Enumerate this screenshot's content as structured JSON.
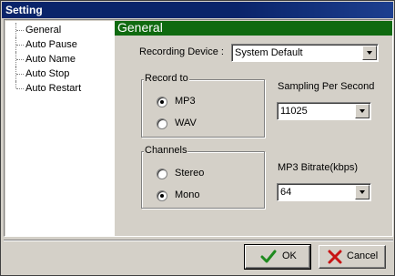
{
  "window": {
    "title": "Setting"
  },
  "tree": {
    "items": [
      {
        "label": "General"
      },
      {
        "label": "Auto Pause"
      },
      {
        "label": "Auto Name"
      },
      {
        "label": "Auto Stop"
      },
      {
        "label": "Auto Restart"
      }
    ]
  },
  "general": {
    "header": "General",
    "recording_device": {
      "label": "Recording Device :",
      "value": "System Default"
    },
    "record_to": {
      "legend": "Record to",
      "options": [
        {
          "label": "MP3",
          "selected": true
        },
        {
          "label": "WAV",
          "selected": false
        }
      ]
    },
    "channels": {
      "legend": "Channels",
      "options": [
        {
          "label": "Stereo",
          "selected": false
        },
        {
          "label": "Mono",
          "selected": true
        }
      ]
    },
    "sampling": {
      "label": "Sampling Per Second",
      "value": "11025"
    },
    "bitrate": {
      "label": "MP3 Bitrate(kbps)",
      "value": "64"
    }
  },
  "buttons": {
    "ok": "OK",
    "cancel": "Cancel"
  },
  "colors": {
    "titlebar": "#0a246a",
    "header": "#0f6a10",
    "ok_check": "#1f8a1f",
    "cancel_x": "#c81414"
  },
  "icons": {
    "ok": "checkmark-icon",
    "cancel": "x-icon"
  }
}
